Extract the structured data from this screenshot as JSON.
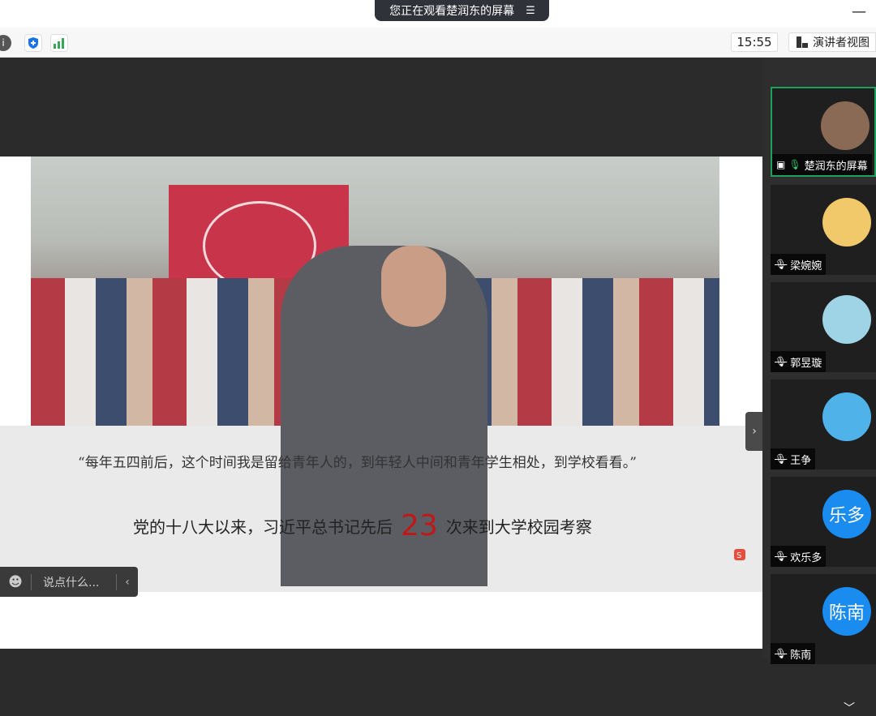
{
  "titlebar": {
    "share_status": "您正在观看楚润东的屏幕",
    "menu_glyph": "☰",
    "minimize_glyph": "—"
  },
  "toolbar": {
    "time": "15:55",
    "presenter_view": "演讲者视图"
  },
  "slide": {
    "quote": "“每年五四前后，这个时间我是留给青年人的，到年轻人中间和青年学生相处，到学校看看。”",
    "stat_prefix": "党的十八大以来，习近平总书记先后",
    "stat_number": "23",
    "stat_suffix": "次来到大学校园考察"
  },
  "chat": {
    "placeholder": "说点什么..."
  },
  "participants": [
    {
      "name": "楚润东的屏幕",
      "avatar_text": "",
      "avatar_color": "#8a6a55",
      "mic": "on",
      "active": true
    },
    {
      "name": "梁婉婉",
      "avatar_text": "",
      "avatar_color": "#f1c86a",
      "mic": "off",
      "active": false
    },
    {
      "name": "郭昱璇",
      "avatar_text": "",
      "avatar_color": "#9fd4e6",
      "mic": "off",
      "active": false
    },
    {
      "name": "王争",
      "avatar_text": "",
      "avatar_color": "#4fb3ea",
      "mic": "off",
      "active": false
    },
    {
      "name": "欢乐多",
      "avatar_text": "乐多",
      "avatar_color": "#1a8cf0",
      "mic": "off",
      "active": false
    },
    {
      "name": "陈南",
      "avatar_text": "陈南",
      "avatar_color": "#1a8cf0",
      "mic": "off",
      "active": false
    }
  ],
  "colors": {
    "accent_green": "#1e9f5a",
    "stat_red": "#c01818",
    "shield_blue": "#1a73e8",
    "signal_green": "#34a853"
  }
}
